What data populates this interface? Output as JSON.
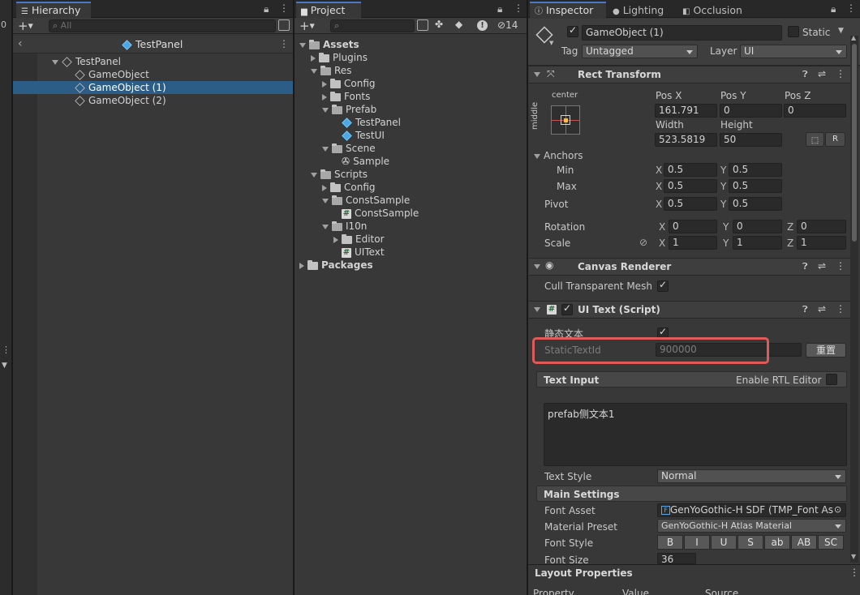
{
  "hierarchy": {
    "tab_label": "Hierarchy",
    "search_placeholder": "All",
    "scene_title": "TestPanel",
    "items": [
      {
        "label": "TestPanel"
      },
      {
        "label": "GameObject"
      },
      {
        "label": "GameObject (1)"
      },
      {
        "label": "GameObject (2)"
      }
    ],
    "left_strip_value": "0"
  },
  "project": {
    "tab_label": "Project",
    "hidden_count": "14",
    "tree": [
      {
        "label": "Assets"
      },
      {
        "label": "Plugins"
      },
      {
        "label": "Res"
      },
      {
        "label": "Config"
      },
      {
        "label": "Fonts"
      },
      {
        "label": "Prefab"
      },
      {
        "label": "TestPanel"
      },
      {
        "label": "TestUI"
      },
      {
        "label": "Scene"
      },
      {
        "label": "Sample"
      },
      {
        "label": "Scripts"
      },
      {
        "label": "Config"
      },
      {
        "label": "ConstSample"
      },
      {
        "label": "ConstSample"
      },
      {
        "label": "I10n"
      },
      {
        "label": "Editor"
      },
      {
        "label": "UIText"
      },
      {
        "label": "Packages"
      }
    ]
  },
  "inspector": {
    "tabs": [
      {
        "label": "Inspector"
      },
      {
        "label": "Lighting"
      },
      {
        "label": "Occlusion"
      }
    ],
    "gameobject": {
      "name": "GameObject (1)",
      "static_label": "Static",
      "tag_label": "Tag",
      "tag_value": "Untagged",
      "layer_label": "Layer",
      "layer_value": "UI"
    },
    "rect_transform": {
      "title": "Rect Transform",
      "anchor_preset_h": "center",
      "anchor_preset_v": "middle",
      "pos_x_label": "Pos X",
      "pos_x": "161.791",
      "pos_y_label": "Pos Y",
      "pos_y": "0",
      "pos_z_label": "Pos Z",
      "pos_z": "0",
      "width_label": "Width",
      "width": "523.5819",
      "height_label": "Height",
      "height": "50",
      "raw_button": "R",
      "anchors_label": "Anchors",
      "min_label": "Min",
      "min_x": "0.5",
      "min_y": "0.5",
      "max_label": "Max",
      "max_x": "0.5",
      "max_y": "0.5",
      "pivot_label": "Pivot",
      "pivot_x": "0.5",
      "pivot_y": "0.5",
      "rotation_label": "Rotation",
      "rot_x": "0",
      "rot_y": "0",
      "rot_z": "0",
      "scale_label": "Scale",
      "scale_x": "1",
      "scale_y": "1",
      "scale_z": "1",
      "axis_x": "X",
      "axis_y": "Y",
      "axis_z": "Z"
    },
    "canvas_renderer": {
      "title": "Canvas Renderer",
      "cull_label": "Cull Transparent Mesh"
    },
    "ui_text": {
      "title": "UI Text (Script)",
      "static_text_label": "静态文本",
      "static_text_id_label": "StaticTextId",
      "static_text_id_value": "900000",
      "reset_button": "重置",
      "text_input_header": "Text Input",
      "rtl_label": "Enable RTL Editor",
      "text_value": "prefab侧文本1",
      "text_style_label": "Text Style",
      "text_style_value": "Normal",
      "main_settings_header": "Main Settings",
      "font_asset_label": "Font Asset",
      "font_asset_value": "GenYoGothic-H SDF (TMP_Font As",
      "material_preset_label": "Material Preset",
      "material_preset_value": "GenYoGothic-H Atlas Material",
      "font_style_label": "Font Style",
      "font_style_buttons": [
        "B",
        "I",
        "U",
        "S",
        "ab",
        "AB",
        "SC"
      ],
      "font_size_label": "Font Size",
      "font_size_value": "36"
    },
    "layout_properties": {
      "title": "Layout Properties",
      "col_property": "Property",
      "col_value": "Value",
      "col_source": "Source"
    }
  },
  "highlight_color": "#e05a5a",
  "selection_color": "#2c5d87",
  "accent_color": "#4a78c4"
}
